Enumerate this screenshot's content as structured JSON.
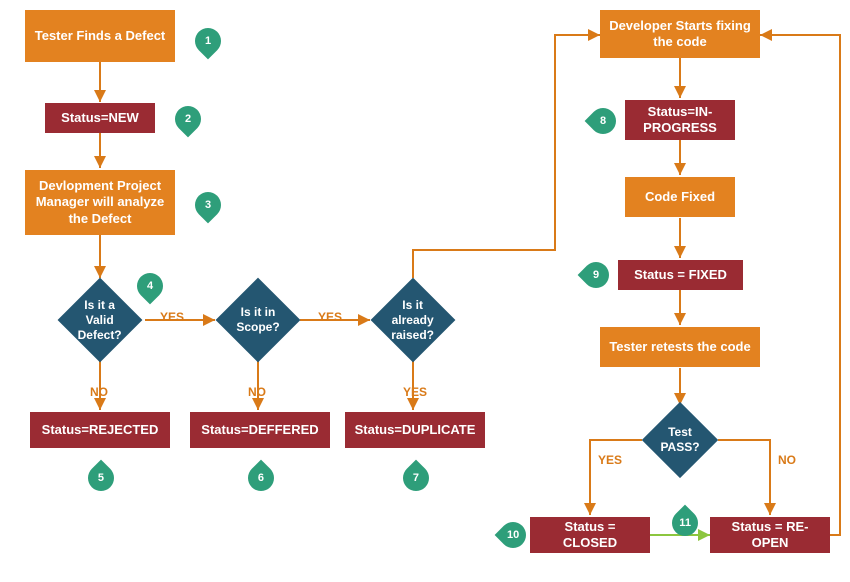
{
  "nodes": {
    "n1": "Tester Finds a Defect",
    "n2": "Status=NEW",
    "n3": "Devlopment Project Manager will analyze the Defect",
    "d4": "Is it a Valid Defect?",
    "d4b": "Is it in Scope?",
    "d4c": "Is it already raised?",
    "n5": "Status=REJECTED",
    "n6": "Status=DEFFERED",
    "n7": "Status=DUPLICATE",
    "r1": "Developer Starts fixing the code",
    "n8": "Status=IN-PROGRESS",
    "r2": "Code Fixed",
    "n9": "Status = FIXED",
    "r3": "Tester retests the code",
    "d10": "Test PASS?",
    "n10": "Status = CLOSED",
    "n11": "Status = RE-OPEN"
  },
  "badges": {
    "b1": "1",
    "b2": "2",
    "b3": "3",
    "b4": "4",
    "b5": "5",
    "b6": "6",
    "b7": "7",
    "b8": "8",
    "b9": "9",
    "b10": "10",
    "b11": "11"
  },
  "labels": {
    "yes": "YES",
    "no": "NO"
  },
  "colors": {
    "orange": "#E38220",
    "maroon": "#9A2B33",
    "navy": "#245671",
    "teal": "#2E9E7A",
    "arrow": "#D97A18",
    "greenArrow": "#8CC63F"
  }
}
